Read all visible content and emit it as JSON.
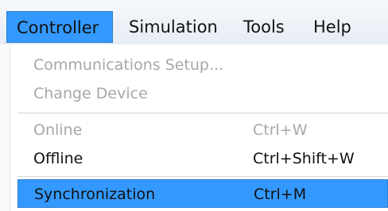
{
  "menubar": {
    "items": [
      {
        "label": "Controller",
        "active": true
      },
      {
        "label": "Simulation"
      },
      {
        "label": "Tools"
      },
      {
        "label": "Help"
      }
    ]
  },
  "dropdown": {
    "items": [
      {
        "label": "Communications Setup...",
        "shortcut": "",
        "enabled": false
      },
      {
        "label": "Change Device",
        "shortcut": "",
        "enabled": false
      },
      {
        "label": "Online",
        "shortcut": "Ctrl+W",
        "enabled": false
      },
      {
        "label": "Offline",
        "shortcut": "Ctrl+Shift+W",
        "enabled": true
      },
      {
        "label": "Synchronization",
        "shortcut": "Ctrl+M",
        "enabled": true,
        "highlighted": true
      }
    ]
  },
  "colors": {
    "highlight": "#3399ff",
    "disabled_text": "#a7a7a7"
  }
}
